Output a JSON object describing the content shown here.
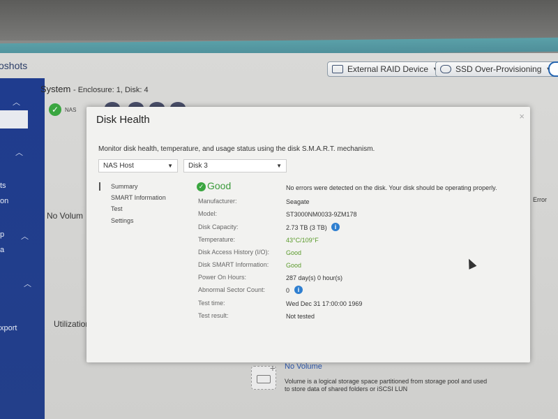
{
  "app": {
    "title_fragment": "oshots"
  },
  "header_buttons": [
    {
      "label": "External RAID Device",
      "icon": "raid-device-icon"
    },
    {
      "label": "SSD Over-Provisioning",
      "icon": "ssd-icon"
    }
  ],
  "sidebar": {
    "texts": [
      "ts",
      "on",
      "p",
      "a",
      "xport"
    ]
  },
  "background": {
    "system_title": "System",
    "system_sub": "- Enclosure: 1, Disk: 4",
    "nas_label": "NAS",
    "no_volume_left": "No Volum",
    "utilization": "Utilization",
    "error_legend": "Error",
    "no_volume_title": "No Volume",
    "no_volume_desc": "Volume is a logical storage space partitioned from storage pool and used to store data of shared folders or iSCSI LUN"
  },
  "modal": {
    "title": "Disk Health",
    "close_glyph": "×",
    "description": "Monitor disk health, temperature, and usage status using the disk S.M.A.R.T. mechanism.",
    "selects": {
      "host": "NAS Host",
      "disk": "Disk 3"
    },
    "nav": [
      "Summary",
      "SMART Information",
      "Test",
      "Settings"
    ],
    "status": {
      "label": "Good",
      "message": "No errors were detected on the disk. Your disk should be operating properly."
    },
    "rows": [
      {
        "label": "Manufacturer:",
        "value": "Seagate"
      },
      {
        "label": "Model:",
        "value": "ST3000NM0033-9ZM178"
      },
      {
        "label": "Disk Capacity:",
        "value": "2.73 TB (3 TB)"
      },
      {
        "label": "Temperature:",
        "value": "43°C/109°F"
      },
      {
        "label": "Disk Access History (I/O):",
        "value": "Good"
      },
      {
        "label": "Disk SMART Information:",
        "value": "Good"
      },
      {
        "label": "Power On Hours:",
        "value": "287 day(s) 0 hour(s)"
      },
      {
        "label": "Abnormal Sector Count:",
        "value": "0"
      },
      {
        "label": "Test time:",
        "value": "Wed Dec 31 17:00:00 1969"
      },
      {
        "label": "Test result:",
        "value": "Not tested"
      }
    ]
  },
  "colors": {
    "sidebar": "#1f3c8e",
    "good_green": "#3aa640",
    "info_blue": "#2f7fd0",
    "link_blue": "#2b55a8"
  }
}
